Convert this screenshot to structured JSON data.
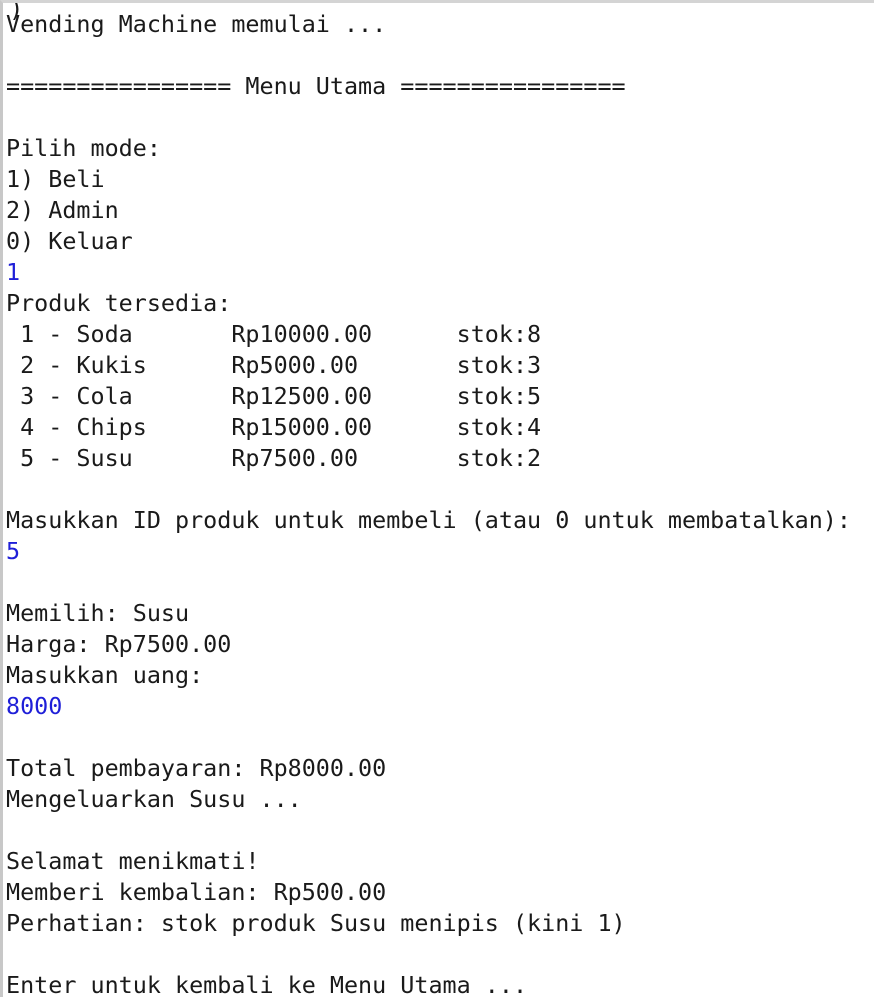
{
  "console": {
    "top_cut_glyph": ")",
    "lines": [
      {
        "text": "Vending Machine memulai ...",
        "type": "output"
      },
      {
        "text": "",
        "type": "output"
      },
      {
        "text": "================ Menu Utama ================",
        "type": "output"
      },
      {
        "text": "",
        "type": "output"
      },
      {
        "text": "Pilih mode:",
        "type": "output"
      },
      {
        "text": "1) Beli",
        "type": "output"
      },
      {
        "text": "2) Admin",
        "type": "output"
      },
      {
        "text": "0) Keluar",
        "type": "output"
      },
      {
        "text": "1",
        "type": "input"
      },
      {
        "text": "Produk tersedia:",
        "type": "output"
      },
      {
        "text": " 1 - Soda       Rp10000.00      stok:8",
        "type": "output"
      },
      {
        "text": " 2 - Kukis      Rp5000.00       stok:3",
        "type": "output"
      },
      {
        "text": " 3 - Cola       Rp12500.00      stok:5",
        "type": "output"
      },
      {
        "text": " 4 - Chips      Rp15000.00      stok:4",
        "type": "output"
      },
      {
        "text": " 5 - Susu       Rp7500.00       stok:2",
        "type": "output"
      },
      {
        "text": "",
        "type": "output"
      },
      {
        "text": "Masukkan ID produk untuk membeli (atau 0 untuk membatalkan):",
        "type": "output"
      },
      {
        "text": "5",
        "type": "input"
      },
      {
        "text": "",
        "type": "output"
      },
      {
        "text": "Memilih: Susu",
        "type": "output"
      },
      {
        "text": "Harga: Rp7500.00",
        "type": "output"
      },
      {
        "text": "Masukkan uang:",
        "type": "output"
      },
      {
        "text": "8000",
        "type": "input"
      },
      {
        "text": "",
        "type": "output"
      },
      {
        "text": "Total pembayaran: Rp8000.00",
        "type": "output"
      },
      {
        "text": "Mengeluarkan Susu ...",
        "type": "output"
      },
      {
        "text": "",
        "type": "output"
      },
      {
        "text": "Selamat menikmati!",
        "type": "output"
      },
      {
        "text": "Memberi kembalian: Rp500.00",
        "type": "output"
      },
      {
        "text": "Perhatian: stok produk Susu menipis (kini 1)",
        "type": "output"
      },
      {
        "text": "",
        "type": "output"
      },
      {
        "text": "Enter untuk kembali ke Menu Utama ...",
        "type": "output"
      }
    ]
  },
  "colors": {
    "background": "#ffffff",
    "output_text": "#1a1a1a",
    "input_text": "#1f1fd8",
    "border": "#c8c8c8"
  }
}
